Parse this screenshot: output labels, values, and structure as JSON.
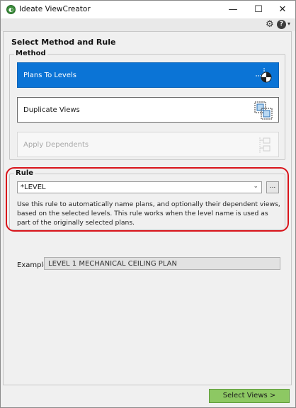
{
  "window": {
    "title": "Ideate ViewCreator",
    "minimize": "—",
    "maximize": "☐",
    "close": "✕"
  },
  "toolbar": {
    "settings_icon": "gear-icon",
    "help_icon": "help-icon",
    "help_glyph": "?",
    "help_caret": "▾"
  },
  "section_title": "Select Method and Rule",
  "method": {
    "group_label": "Method",
    "buttons": [
      {
        "label": "Plans To Levels",
        "state": "selected",
        "icon": "plans-to-levels-icon"
      },
      {
        "label": "Duplicate Views",
        "state": "enabled",
        "icon": "duplicate-views-icon"
      },
      {
        "label": "Apply Dependents",
        "state": "disabled",
        "icon": "apply-dependents-icon"
      }
    ]
  },
  "rule": {
    "group_label": "Rule",
    "selected": "*LEVEL",
    "browse_label": "...",
    "description": "Use this rule to automatically name plans, and optionally their dependent views, based on the selected levels. This rule works when the level name is used as part of the originally selected plans."
  },
  "example": {
    "label": "Example:",
    "value": "LEVEL 1 MECHANICAL CEILING PLAN"
  },
  "footer": {
    "select_views_label": "Select Views >"
  },
  "colors": {
    "selected_method": "#0b74d6",
    "highlight": "#d9141b",
    "primary_button": "#8dc863"
  }
}
